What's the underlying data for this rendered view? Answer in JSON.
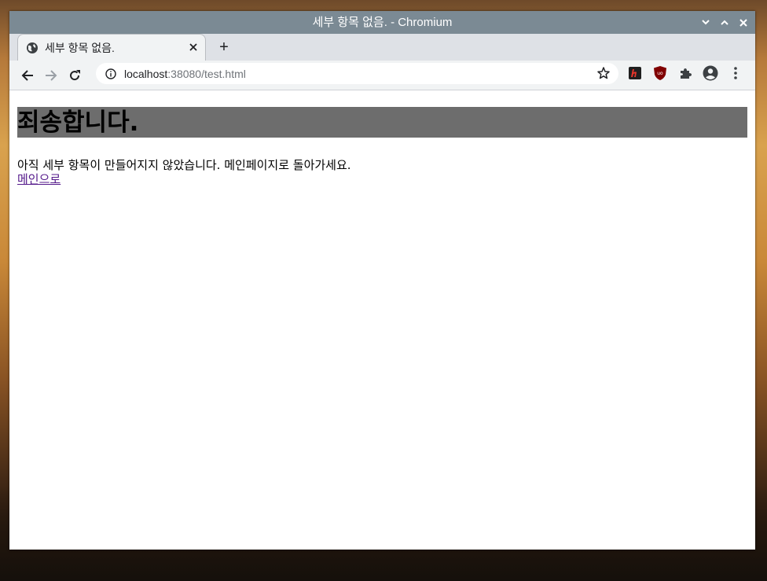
{
  "window": {
    "title": "세부 항목 없음. - Chromium",
    "controls": {
      "minimize": "⌄",
      "maximize": "⌃",
      "close": "✕"
    }
  },
  "tab": {
    "title": "세부 항목 없음.",
    "close": "✕",
    "new_tab": "+"
  },
  "address_bar": {
    "host": "localhost",
    "path": ":38080/test.html"
  },
  "icons": {
    "back": "arrow-left-icon",
    "forward": "arrow-right-icon",
    "reload": "reload-icon",
    "info": "info-icon",
    "bookmark": "star-icon",
    "extensions": [
      "h-extension-icon",
      "ublock-icon",
      "puzzle-icon",
      "account-icon",
      "menu-icon"
    ]
  },
  "page": {
    "heading": "죄송합니다.",
    "message": "아직 세부 항목이 만들어지지 않았습니다. 메인페이지로 돌아가세요.",
    "link": "메인으로"
  },
  "colors": {
    "titlebar": "#7b8a94",
    "heading_bg": "#6d6d6d",
    "link": "#551a8b"
  }
}
